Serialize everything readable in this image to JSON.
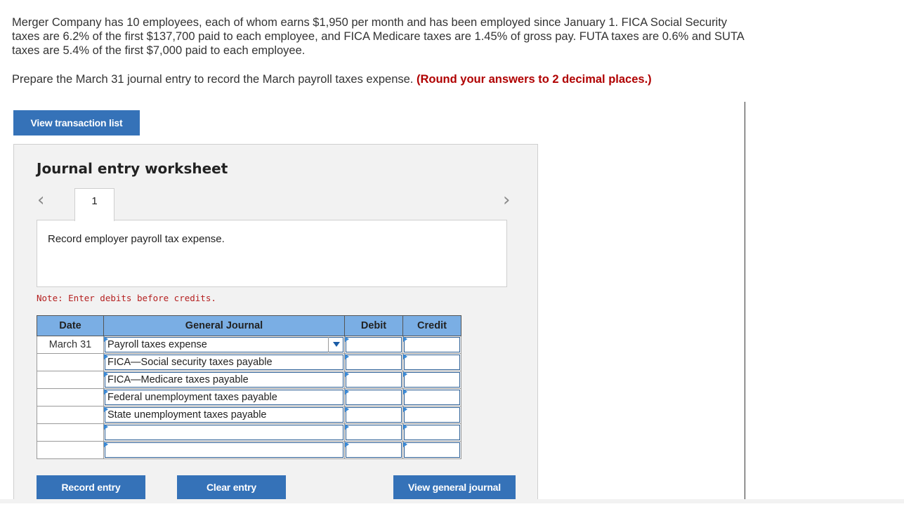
{
  "problem": {
    "text": "Merger Company has 10 employees, each of whom earns $1,950 per month and has been employed since January 1. FICA Social Security taxes are 6.2% of the first $137,700 paid to each employee, and FICA Medicare taxes are 1.45% of gross pay. FUTA taxes are 0.6% and SUTA taxes are 5.4% of the first $7,000 paid to each employee.",
    "instruction": "Prepare the March 31 journal entry to record the March payroll taxes expense.",
    "hint": "(Round your answers to 2 decimal places.)"
  },
  "buttons": {
    "view_transaction_list": "View transaction list",
    "record_entry": "Record entry",
    "clear_entry": "Clear entry",
    "view_general_journal": "View general journal"
  },
  "worksheet": {
    "title": "Journal entry worksheet",
    "active_tab": "1",
    "description": "Record employer payroll tax expense.",
    "note": "Note: Enter debits before credits."
  },
  "journal": {
    "headers": [
      "Date",
      "General Journal",
      "Debit",
      "Credit"
    ],
    "rows": [
      {
        "date": "March 31",
        "account": "Payroll taxes expense",
        "debit": "",
        "credit": ""
      },
      {
        "date": "",
        "account": "FICA—Social security taxes payable",
        "debit": "",
        "credit": ""
      },
      {
        "date": "",
        "account": "FICA—Medicare taxes payable",
        "debit": "",
        "credit": ""
      },
      {
        "date": "",
        "account": "Federal unemployment taxes payable",
        "debit": "",
        "credit": ""
      },
      {
        "date": "",
        "account": "State unemployment taxes payable",
        "debit": "",
        "credit": ""
      },
      {
        "date": "",
        "account": "",
        "debit": "",
        "credit": ""
      },
      {
        "date": "",
        "account": "",
        "debit": "",
        "credit": ""
      }
    ]
  },
  "colors": {
    "button": "#3572b8",
    "header": "#7aaee4",
    "hint": "#b00000"
  }
}
